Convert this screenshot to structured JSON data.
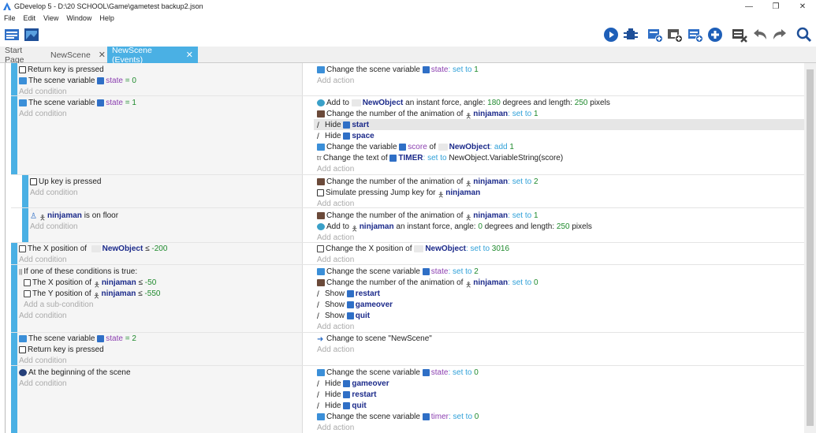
{
  "window": {
    "title": "GDevelop 5 - D:\\20 SCHOOL\\Game\\gametest backup2.json",
    "minimize": "—",
    "restore": "❐",
    "close": "✕"
  },
  "menu": [
    "File",
    "Edit",
    "View",
    "Window",
    "Help"
  ],
  "tabs": [
    {
      "label": "Start Page"
    },
    {
      "label": "NewScene",
      "close": "✕"
    },
    {
      "label": "NewScene (Events)",
      "close": "✕"
    }
  ],
  "add_condition": "Add condition",
  "add_action": "Add action",
  "add_subcondition": "Add a sub-condition",
  "events": {
    "e1": {
      "c1": "Return key is pressed",
      "c2a": "The scene variable",
      "c2v": "state",
      "c2b": "= 0",
      "a1a": "Change the scene variable",
      "a1v": "state",
      "a1b": ": set to",
      "a1n": "1"
    },
    "e2": {
      "c1a": "The scene variable",
      "c1v": "state",
      "c1b": "= 1",
      "a1a": "Add to",
      "a1o": "NewObject",
      "a1b": "an instant force, angle:",
      "a1n1": "180",
      "a1c": "degrees and length:",
      "a1n2": "250",
      "a1d": "pixels",
      "a2a": "Change the number of the animation of",
      "a2o": "ninjaman",
      "a2b": ": set to",
      "a2n": "1",
      "a3a": "Hide",
      "a3o": "start",
      "a4a": "Hide",
      "a4o": "space",
      "a5a": "Change the variable",
      "a5v": "score",
      "a5b": "of",
      "a5o": "NewObject",
      "a5c": ": add",
      "a5n": "1",
      "a6a": "Change the text of",
      "a6o": "TIMER",
      "a6b": ": set to",
      "a6c": "NewObject.VariableString(score)"
    },
    "e3": {
      "c1": "Up key is pressed",
      "a1a": "Change the number of the animation of",
      "a1o": "ninjaman",
      "a1b": ": set to",
      "a1n": "2",
      "a2a": "Simulate pressing Jump key for",
      "a2o": "ninjaman"
    },
    "e4": {
      "c1o": "ninjaman",
      "c1b": "is on floor",
      "a1a": "Change the number of the animation of",
      "a1o": "ninjaman",
      "a1b": ": set to",
      "a1n": "1",
      "a2a": "Add to",
      "a2o": "ninjaman",
      "a2b": "an instant force, angle:",
      "a2n1": "0",
      "a2c": "degrees and length:",
      "a2n2": "250",
      "a2d": "pixels"
    },
    "e5": {
      "c1a": "The X position of",
      "c1o": "NewObject",
      "c1b": "≤",
      "c1n": "-200",
      "a1a": "Change the X position of",
      "a1o": "NewObject",
      "a1b": ": set to",
      "a1n": "3016"
    },
    "e6": {
      "c1": "If one of these conditions is true:",
      "s1a": "The X position of",
      "s1o": "ninjaman",
      "s1b": "≤",
      "s1n": "-50",
      "s2a": "The Y position of",
      "s2o": "ninjaman",
      "s2b": "≤",
      "s2n": "-550",
      "a1a": "Change the scene variable",
      "a1v": "state",
      "a1b": ": set to",
      "a1n": "2",
      "a2a": "Change the number of the animation of",
      "a2o": "ninjaman",
      "a2b": ": set to",
      "a2n": "0",
      "a3a": "Show",
      "a3o": "restart",
      "a4a": "Show",
      "a4o": "gameover",
      "a5a": "Show",
      "a5o": "quit"
    },
    "e7": {
      "c1a": "The scene variable",
      "c1v": "state",
      "c1b": "= 2",
      "c2": "Return key is pressed",
      "a1": "Change to scene \"NewScene\""
    },
    "e8": {
      "c1": "At the beginning of the scene",
      "a1a": "Change the scene variable",
      "a1v": "state",
      "a1b": ": set to",
      "a1n": "0",
      "a2a": "Hide",
      "a2o": "gameover",
      "a3a": "Hide",
      "a3o": "restart",
      "a4a": "Hide",
      "a4o": "quit",
      "a5a": "Change the scene variable",
      "a5v": "timer",
      "a5b": ": set to",
      "a5n": "0"
    }
  },
  "colors": {
    "accent": "#4ab0e4",
    "keyword": "#2fa0d8",
    "number": "#1f8a2d",
    "object": "#1b2a8a",
    "variable": "#8b3fb0"
  },
  "toolbar_icons": [
    "project-manager-icon",
    "scene-editor-icon",
    "preview-icon",
    "debugger-icon",
    "add-event-icon",
    "add-subevent-icon",
    "add-comment-icon",
    "add-other-icon",
    "delete-icon",
    "undo-icon",
    "redo-icon",
    "search-icon"
  ]
}
